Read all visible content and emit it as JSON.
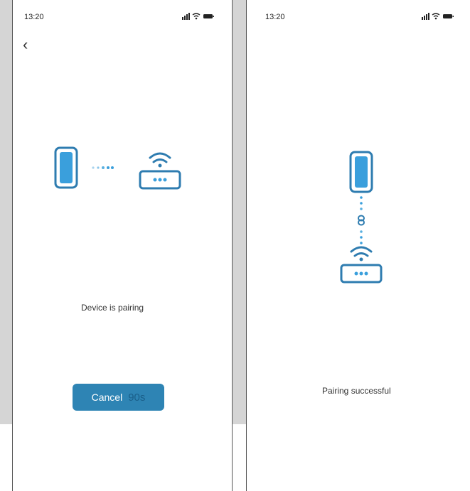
{
  "left_screen": {
    "status_time": "13:20",
    "status_message": "Device is pairing",
    "cancel_label": "Cancel",
    "countdown": "90s"
  },
  "right_screen": {
    "status_time": "13:20",
    "status_message": "Pairing successful"
  },
  "colors": {
    "accent_blue": "#2e84b4",
    "icon_stroke": "#2e7cb0",
    "icon_fill": "#3a9fdc",
    "dots": "#5ab0e0"
  }
}
